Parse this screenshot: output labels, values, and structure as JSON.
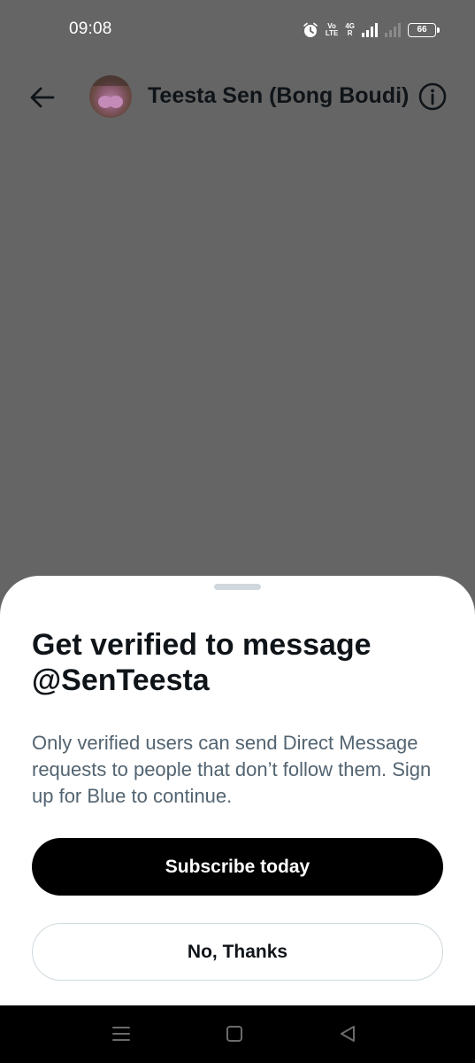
{
  "status_bar": {
    "time": "09:08",
    "volte_top": "Vo",
    "volte_bottom": "LTE",
    "network_top": "4G",
    "network_bottom": "R",
    "battery": "66"
  },
  "header": {
    "title": "Teesta Sen (Bong Boudi)",
    "back_icon": "arrow-left-icon",
    "info_icon": "info-circle-icon"
  },
  "sheet": {
    "title": "Get verified to message @SenTeesta",
    "body": "Only verified users can send Direct Message requests to people that don’t follow them. Sign up for Blue to continue.",
    "subscribe_label": "Subscribe today",
    "decline_label": "No, Thanks"
  },
  "nav": {
    "recents_icon": "menu-icon",
    "home_icon": "square-icon",
    "back_icon": "triangle-back-icon"
  },
  "colors": {
    "overlay": "#656565",
    "sheet": "#ffffff",
    "primary_button": "#000000",
    "secondary_border": "#cfd9de",
    "body_text": "#536471"
  }
}
